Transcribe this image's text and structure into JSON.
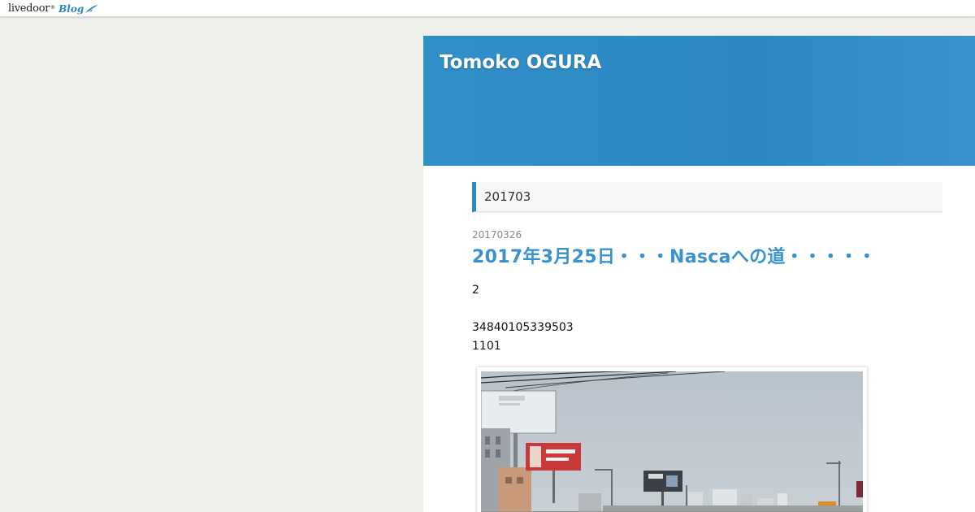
{
  "topbar": {
    "logo_word": "livedoor",
    "logo_tm": "®",
    "logo_blog": "Blog"
  },
  "header": {
    "blog_title": "Tomoko OGURA",
    "bg_color": "#2d88c4"
  },
  "archive": {
    "title": "201703"
  },
  "post": {
    "date": "20170326",
    "title": "2017年3月25日・・・Nascaへの道・・・・・",
    "lines": [
      "2",
      "34840105339503",
      "1101"
    ]
  },
  "colors": {
    "accent": "#2d88c4",
    "link": "#3a92cc",
    "page_bg": "#efefeb"
  }
}
